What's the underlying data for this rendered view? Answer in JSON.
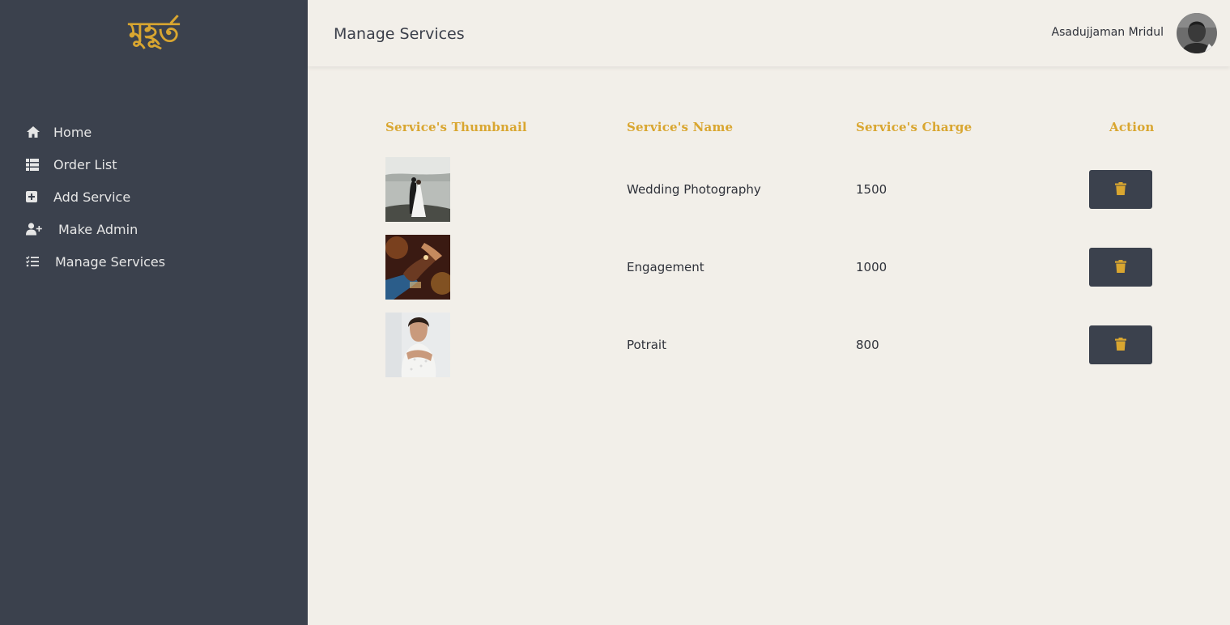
{
  "app": {
    "logo_text": "মুহূর্ত"
  },
  "sidebar": {
    "items": [
      {
        "label": "Home",
        "icon": "home-icon"
      },
      {
        "label": "Order List",
        "icon": "list-icon"
      },
      {
        "label": "Add Service",
        "icon": "plus-square-icon"
      },
      {
        "label": "Make Admin",
        "icon": "user-plus-icon"
      },
      {
        "label": "Manage Services",
        "icon": "tasks-icon"
      }
    ]
  },
  "header": {
    "title": "Manage Services",
    "user_name": "Asadujjaman Mridul",
    "avatar_icon": "user-avatar"
  },
  "table": {
    "headers": [
      "Service's Thumbnail",
      "Service's Name",
      "Service's Charge",
      "Action"
    ],
    "rows": [
      {
        "name": "Wedding Photography",
        "charge": "1500",
        "thumbnail": "wedding-couple-photo",
        "action_icon": "trash-icon"
      },
      {
        "name": "Engagement",
        "charge": "1000",
        "thumbnail": "engagement-ring-hands-photo",
        "action_icon": "trash-icon"
      },
      {
        "name": "Potrait",
        "charge": "800",
        "thumbnail": "bride-portrait-photo",
        "action_icon": "trash-icon"
      }
    ]
  },
  "colors": {
    "sidebar_bg": "#3b414d",
    "accent_gold": "#d9a630",
    "page_bg": "#f2efe9",
    "text_dark": "#2f323a"
  }
}
